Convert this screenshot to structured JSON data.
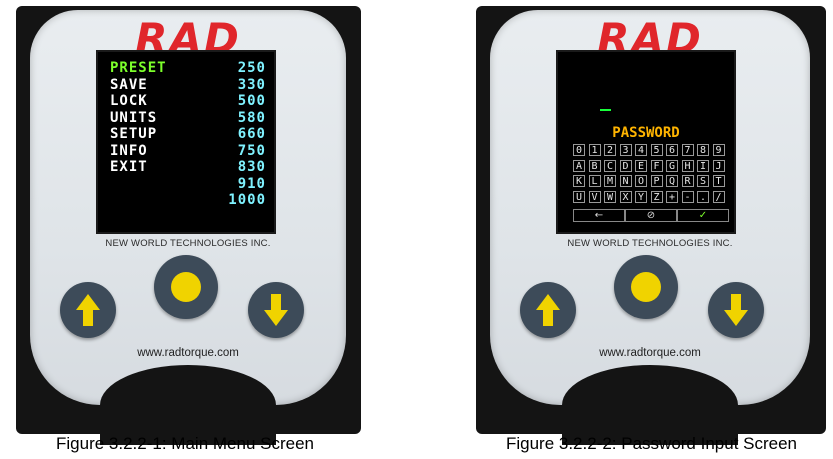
{
  "figure1": {
    "logo": "RAD",
    "brand": "NEW WORLD TECHNOLOGIES INC.",
    "url": "www.radtorque.com",
    "caption": "Figure 3.2.2-1: Main Menu Screen",
    "menu": [
      {
        "label": "PRESET",
        "value": "250",
        "active": true
      },
      {
        "label": "SAVE",
        "value": "330",
        "active": false
      },
      {
        "label": "LOCK",
        "value": "500",
        "active": false
      },
      {
        "label": "UNITS",
        "value": "580",
        "active": false
      },
      {
        "label": "SETUP",
        "value": "660",
        "active": false
      },
      {
        "label": "INFO",
        "value": "750",
        "active": false
      },
      {
        "label": "EXIT",
        "value": "830",
        "active": false
      },
      {
        "label": "",
        "value": "910",
        "active": false
      },
      {
        "label": "",
        "value": "1000",
        "active": false
      }
    ]
  },
  "figure2": {
    "logo": "RAD",
    "brand": "NEW WORLD TECHNOLOGIES INC.",
    "url": "www.radtorque.com",
    "caption": "Figure 3.2.2-2: Password Input Screen",
    "title": "PASSWORD",
    "keys": [
      [
        "0",
        "1",
        "2",
        "3",
        "4",
        "5",
        "6",
        "7",
        "8",
        "9"
      ],
      [
        "A",
        "B",
        "C",
        "D",
        "E",
        "F",
        "G",
        "H",
        "I",
        "J"
      ],
      [
        "K",
        "L",
        "M",
        "N",
        "O",
        "P",
        "Q",
        "R",
        "S",
        "T"
      ],
      [
        "U",
        "V",
        "W",
        "X",
        "Y",
        "Z",
        "+",
        "-",
        ".",
        "/"
      ]
    ],
    "bottom_keys": [
      "←",
      "⊘",
      "✓"
    ]
  },
  "colors": {
    "logo_red": "#e0262b",
    "button_dark": "#3d4b59",
    "button_yellow": "#f0d300",
    "menu_active": "#7dff2b",
    "menu_value": "#7ff2ff",
    "password_title": "#ffb400",
    "cursor_green": "#18ff3b"
  },
  "icons": {
    "up": "up-arrow-icon",
    "down": "down-arrow-icon",
    "center": "select-dot-icon"
  }
}
